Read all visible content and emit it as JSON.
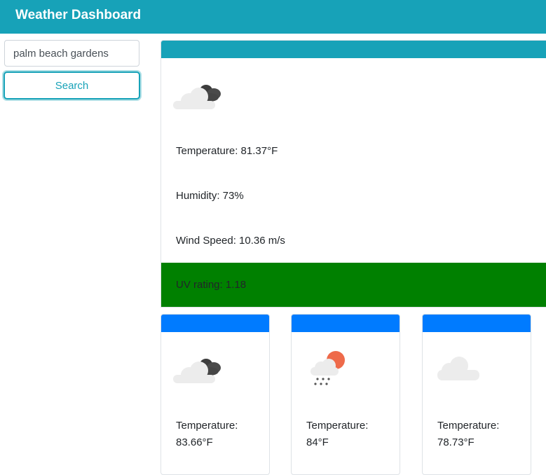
{
  "header": {
    "title": "Weather Dashboard"
  },
  "search": {
    "value": "palm beach gardens",
    "button_label": "Search"
  },
  "current": {
    "icon": "cloud-dark-icon",
    "temperature": "Temperature: 81.37°F",
    "humidity": "Humidity: 73%",
    "wind_speed": "Wind Speed: 10.36 m/s",
    "uv": "UV rating: 1.18"
  },
  "forecast": [
    {
      "icon": "cloud-dark-icon",
      "temperature_label": "Temperature:",
      "temperature_value": "83.66°F"
    },
    {
      "icon": "sun-rain-icon",
      "temperature_label": "Temperature:",
      "temperature_value": "84°F"
    },
    {
      "icon": "cloud-icon",
      "temperature_label": "Temperature:",
      "temperature_value": "78.73°F"
    }
  ],
  "colors": {
    "header": "#17a2b8",
    "forecast_header": "#007bff",
    "uv_good": "#008000"
  }
}
